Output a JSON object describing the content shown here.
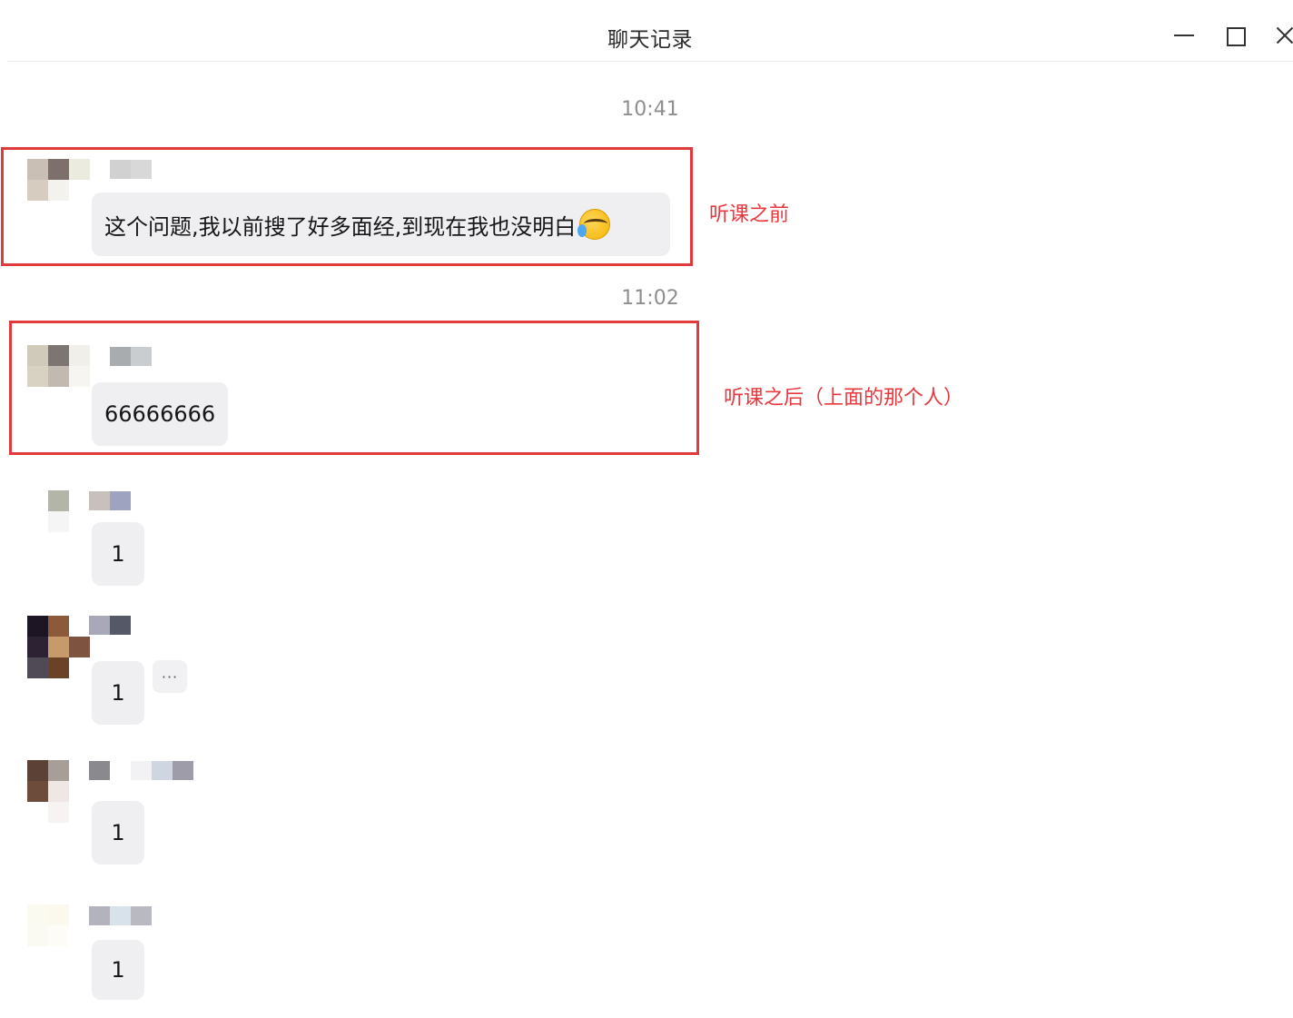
{
  "window": {
    "title": "聊天记录",
    "controls": {
      "minimize": "minimize",
      "maximize": "maximize",
      "close": "close"
    }
  },
  "timestamps": [
    "10:41",
    "11:02"
  ],
  "annotations": [
    {
      "label": "听课之前",
      "color": "#e0393e"
    },
    {
      "label": "听课之后（上面的那个人）",
      "color": "#e0393e"
    }
  ],
  "messages": [
    {
      "text": "这个问题,我以前搜了好多面经,到现在我也没明白",
      "emoji": "crying-laughing-emoji"
    },
    {
      "text": "66666666"
    },
    {
      "text": "1"
    },
    {
      "text": "1",
      "more": "···"
    },
    {
      "text": "1"
    },
    {
      "text": "1"
    }
  ]
}
